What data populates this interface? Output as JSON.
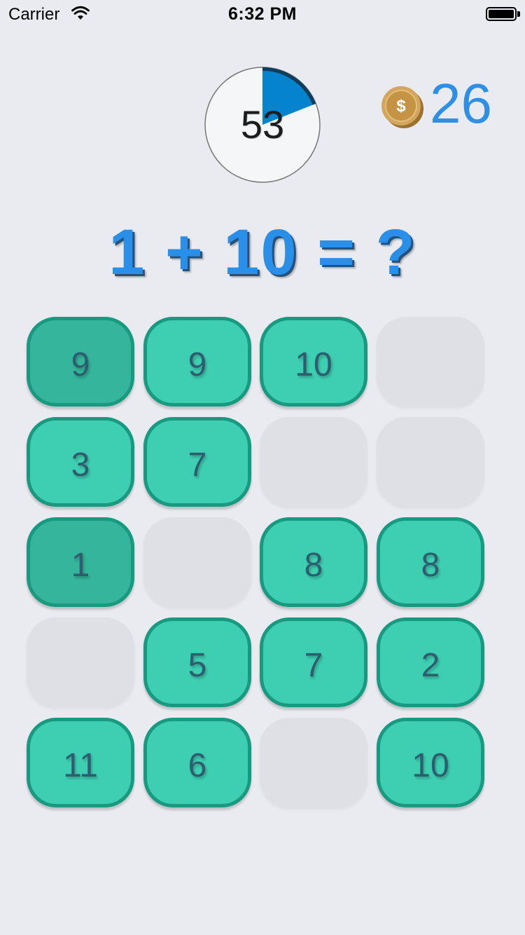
{
  "status_bar": {
    "carrier": "Carrier",
    "time": "6:32 PM",
    "battery_level": 1.0
  },
  "timer": {
    "value": "53",
    "elapsed_fraction": 0.19,
    "fill_color": "#0583cc",
    "rim_color": "#0f3d5c"
  },
  "coins": {
    "icon": "dollar-coin-icon",
    "count": "26",
    "color": "#2d8fe6"
  },
  "equation": {
    "text": "1 + 10 = ?"
  },
  "grid": {
    "columns": 4,
    "rows": 5,
    "tiles": [
      {
        "label": "9",
        "state": "selected"
      },
      {
        "label": "9",
        "state": "normal"
      },
      {
        "label": "10",
        "state": "normal"
      },
      {
        "label": "",
        "state": "empty"
      },
      {
        "label": "3",
        "state": "normal"
      },
      {
        "label": "7",
        "state": "normal"
      },
      {
        "label": "",
        "state": "empty"
      },
      {
        "label": "",
        "state": "empty"
      },
      {
        "label": "1",
        "state": "selected"
      },
      {
        "label": "",
        "state": "empty"
      },
      {
        "label": "8",
        "state": "normal"
      },
      {
        "label": "8",
        "state": "normal"
      },
      {
        "label": "",
        "state": "empty"
      },
      {
        "label": "5",
        "state": "normal"
      },
      {
        "label": "7",
        "state": "normal"
      },
      {
        "label": "2",
        "state": "normal"
      },
      {
        "label": "11",
        "state": "normal"
      },
      {
        "label": "6",
        "state": "normal"
      },
      {
        "label": "",
        "state": "empty"
      },
      {
        "label": "10",
        "state": "normal"
      }
    ],
    "tile_color": "#3ecfb2",
    "selected_tile_color": "#35b59b",
    "border_color": "#179a80",
    "empty_color": "#dfe0e5"
  }
}
